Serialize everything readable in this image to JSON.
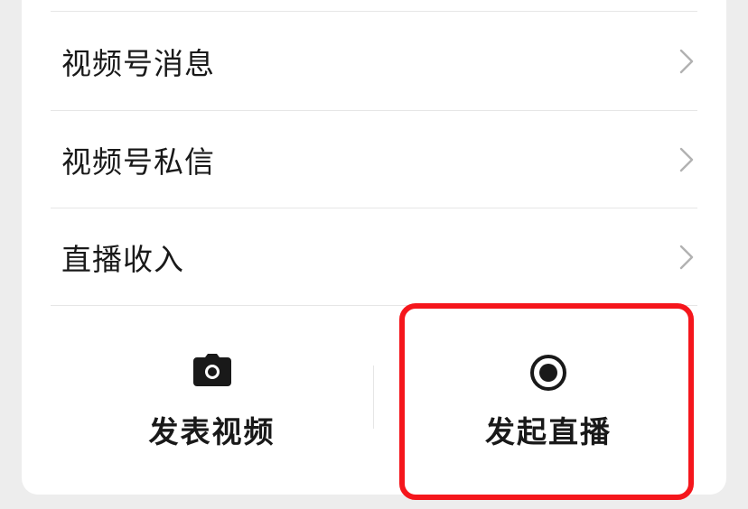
{
  "menu": {
    "items": [
      {
        "label": "视频号消息"
      },
      {
        "label": "视频号私信"
      },
      {
        "label": "直播收入"
      }
    ]
  },
  "actions": {
    "post_video": {
      "label": "发表视频",
      "icon": "camera-icon"
    },
    "start_live": {
      "label": "发起直播",
      "icon": "record-icon"
    }
  },
  "highlight": {
    "color": "#f5161c",
    "target": "start-live-button"
  }
}
